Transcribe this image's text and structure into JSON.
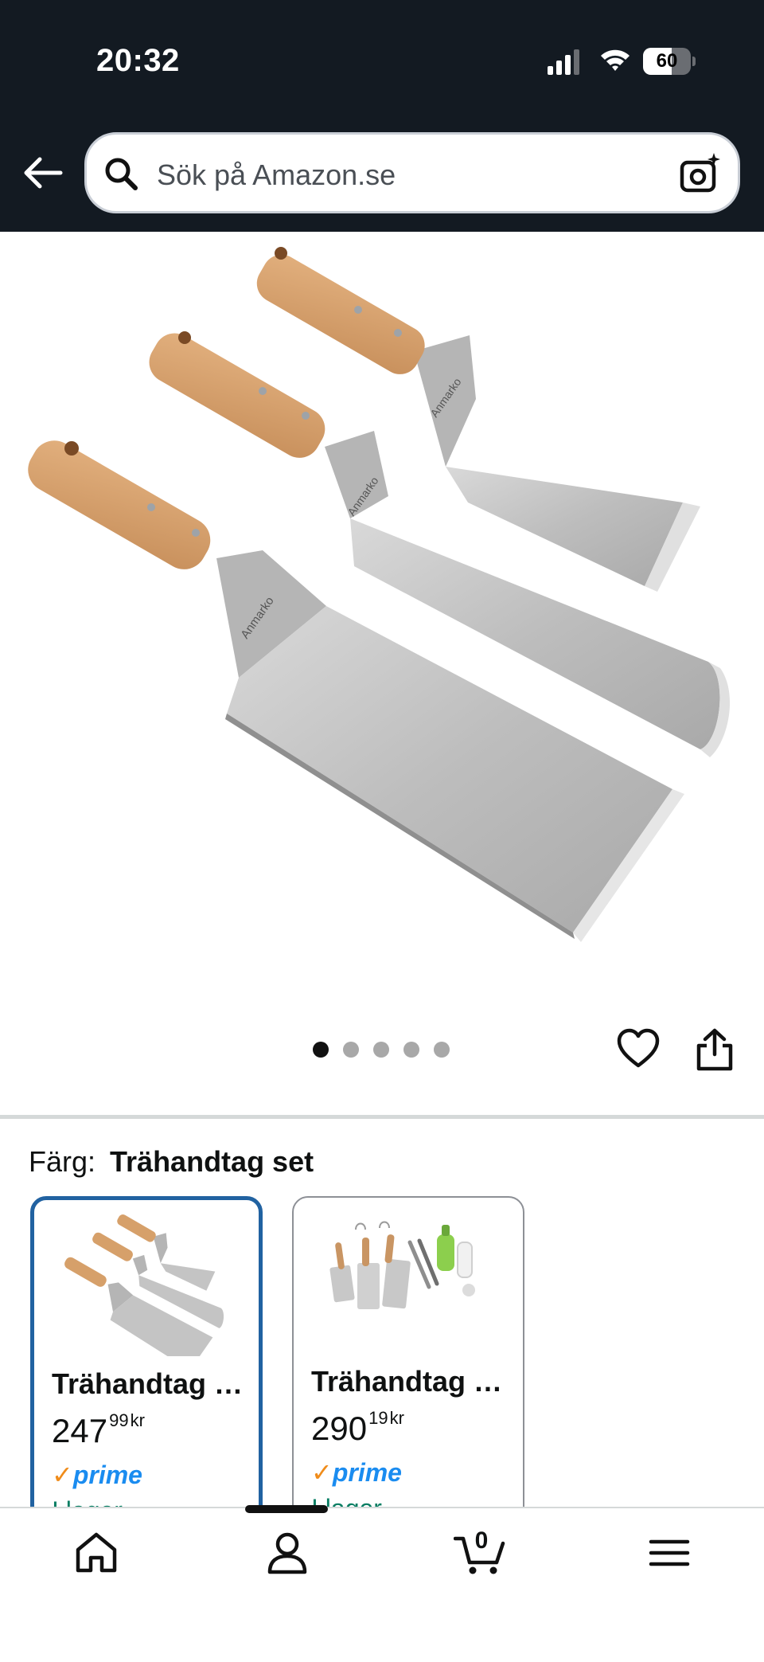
{
  "status_bar": {
    "time": "20:32",
    "battery": "60",
    "battery_level": 0.6
  },
  "search": {
    "placeholder": "Sök på Amazon.se"
  },
  "gallery": {
    "image_count": 5,
    "active_index": 0,
    "brand_mark": "Anmarko"
  },
  "variation": {
    "label": "Färg:",
    "selected": "Trähandtag set"
  },
  "options": [
    {
      "name": "Trähandtag set",
      "price_whole": "247",
      "price_fraction": "99",
      "currency": "kr",
      "prime": "prime",
      "stock": "I lager",
      "selected": true
    },
    {
      "name": "Trähandtag set",
      "price_whole": "290",
      "price_fraction": "19",
      "currency": "kr",
      "prime": "prime",
      "stock": "I lager",
      "selected": false
    }
  ],
  "bottom_nav": {
    "items": [
      "home-icon",
      "account-icon",
      "cart-icon",
      "menu-icon"
    ],
    "cart_count": "0"
  }
}
